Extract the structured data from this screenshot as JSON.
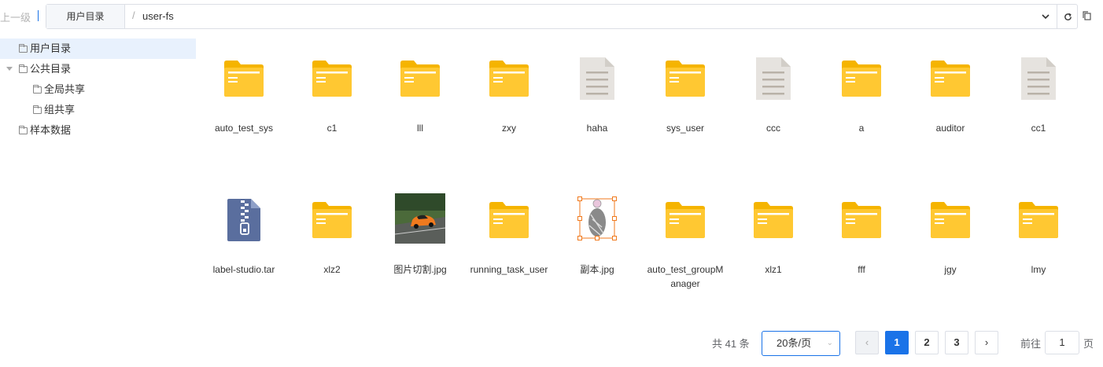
{
  "topbar": {
    "up_label": "上一级",
    "root_label": "用户目录",
    "path_separator": "/",
    "path": "user-fs"
  },
  "sidebar": {
    "items": [
      {
        "label": "用户目录"
      },
      {
        "label": "公共目录"
      },
      {
        "label": "全局共享"
      },
      {
        "label": "组共享"
      },
      {
        "label": "样本数据"
      }
    ]
  },
  "files": [
    {
      "name": "auto_test_sys",
      "icon": "folder-icon"
    },
    {
      "name": "c1",
      "icon": "folder-icon"
    },
    {
      "name": "lll",
      "icon": "folder-icon"
    },
    {
      "name": "zxy",
      "icon": "folder-icon"
    },
    {
      "name": "haha",
      "icon": "file-icon"
    },
    {
      "name": "sys_user",
      "icon": "folder-icon"
    },
    {
      "name": "ccc",
      "icon": "file-icon"
    },
    {
      "name": "a",
      "icon": "folder-icon"
    },
    {
      "name": "auditor",
      "icon": "folder-icon"
    },
    {
      "name": "cc1",
      "icon": "file-icon"
    },
    {
      "name": "label-studio.tar",
      "icon": "archive-icon"
    },
    {
      "name": "xlz2",
      "icon": "folder-icon"
    },
    {
      "name": "图片切割.jpg",
      "icon": "image-thumbnail"
    },
    {
      "name": "running_task_user",
      "icon": "folder-icon"
    },
    {
      "name": "副本.jpg",
      "icon": "image-thumbnail"
    },
    {
      "name": "auto_test_groupManager",
      "icon": "folder-icon"
    },
    {
      "name": "xlz1",
      "icon": "folder-icon"
    },
    {
      "name": "fff",
      "icon": "folder-icon"
    },
    {
      "name": "jgy",
      "icon": "folder-icon"
    },
    {
      "name": "lmy",
      "icon": "folder-icon"
    }
  ],
  "pagination": {
    "total_label": "共 41 条",
    "page_size": "20条/页",
    "pages": [
      "1",
      "2",
      "3"
    ],
    "current": "1",
    "goto_prefix": "前往",
    "goto_value": "1",
    "goto_suffix": "页"
  },
  "colors": {
    "accent": "#1a73e8",
    "folder": "#ffc832",
    "folder_dark": "#f5b400",
    "file": "#e6e3df",
    "archive": "#5a6e9e"
  }
}
